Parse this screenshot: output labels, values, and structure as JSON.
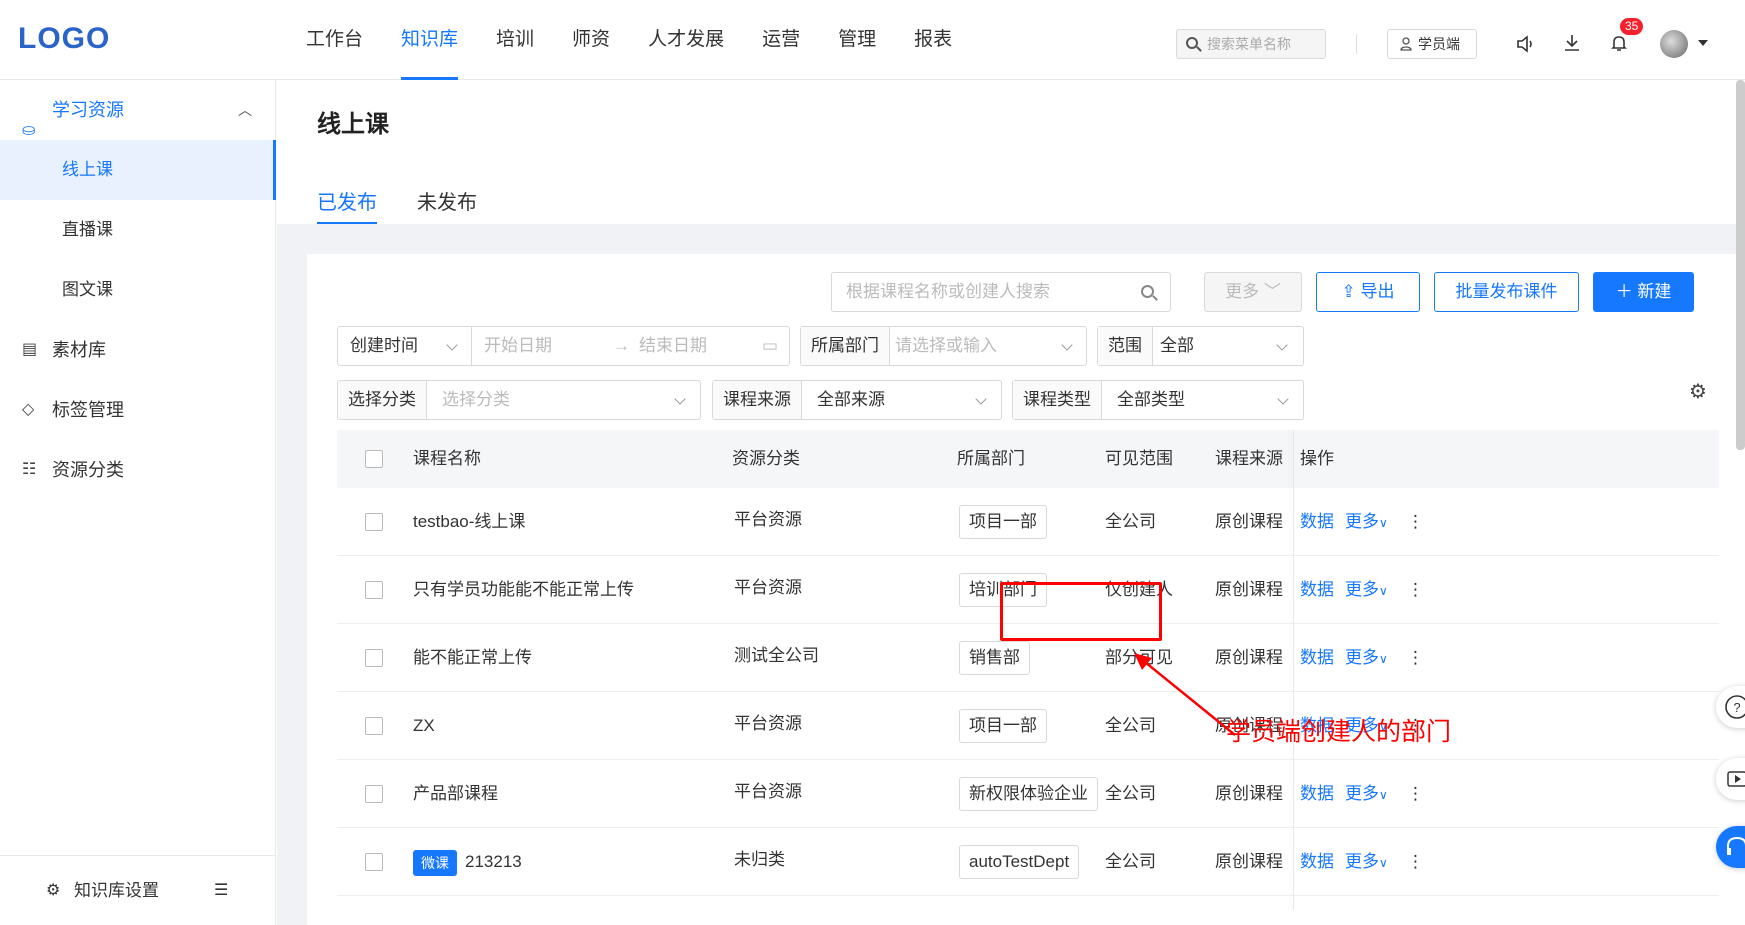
{
  "header": {
    "logo": "LOGO",
    "nav": [
      "工作台",
      "知识库",
      "培训",
      "师资",
      "人才发展",
      "运营",
      "管理",
      "报表"
    ],
    "active_nav": 1,
    "search_placeholder": "搜索菜单名称",
    "student_label": "学员端",
    "notification_count": "35"
  },
  "sidebar": {
    "group_label": "学习资源",
    "sub_items": [
      "线上课",
      "直播课",
      "图文课"
    ],
    "active_sub": 0,
    "top_items": [
      "素材库",
      "标签管理",
      "资源分类"
    ],
    "settings_label": "知识库设置"
  },
  "page": {
    "title": "线上课",
    "tabs": [
      "已发布",
      "未发布"
    ],
    "active_tab": 0
  },
  "toolbar": {
    "search_placeholder": "根据课程名称或创建人搜索",
    "more_label": "更多",
    "export_label": "导出",
    "batch_label": "批量发布课件",
    "new_label": "新建"
  },
  "filters": {
    "time_select": "创建时间",
    "start_placeholder": "开始日期",
    "end_placeholder": "结束日期",
    "dept_label": "所属部门",
    "dept_placeholder": "请选择或输入",
    "scope_label": "范围",
    "scope_value": "全部",
    "category_label": "选择分类",
    "category_placeholder": "选择分类",
    "source_label": "课程来源",
    "source_value": "全部来源",
    "type_label": "课程类型",
    "type_value": "全部类型"
  },
  "table": {
    "columns": [
      "课程名称",
      "资源分类",
      "所属部门",
      "可见范围",
      "课程来源",
      "操作"
    ],
    "action_data": "数据",
    "action_more": "更多",
    "rows": [
      {
        "name": "testbao-线上课",
        "tag": "",
        "category": "平台资源",
        "dept": "项目一部",
        "scope": "全公司",
        "source": "原创课程"
      },
      {
        "name": "只有学员功能能不能正常上传",
        "tag": "",
        "category": "平台资源",
        "dept": "培训部门",
        "scope": "仅创建人",
        "source": "原创课程"
      },
      {
        "name": "能不能正常上传",
        "tag": "",
        "category": "测试全公司",
        "dept": "销售部",
        "scope": "部分可见",
        "source": "原创课程"
      },
      {
        "name": "ZX",
        "tag": "",
        "category": "平台资源",
        "dept": "项目一部",
        "scope": "全公司",
        "source": "原创课程"
      },
      {
        "name": "产品部课程",
        "tag": "",
        "category": "平台资源",
        "dept": "新权限体验企业",
        "scope": "全公司",
        "source": "原创课程"
      },
      {
        "name": "213213",
        "tag": "微课",
        "category": "未归类",
        "dept": "autoTestDept",
        "scope": "全公司",
        "source": "原创课程"
      }
    ]
  },
  "annotation": {
    "text": "学员端创建人的部门",
    "color": "#ff0000"
  },
  "colors": {
    "accent": "#1677ff"
  }
}
